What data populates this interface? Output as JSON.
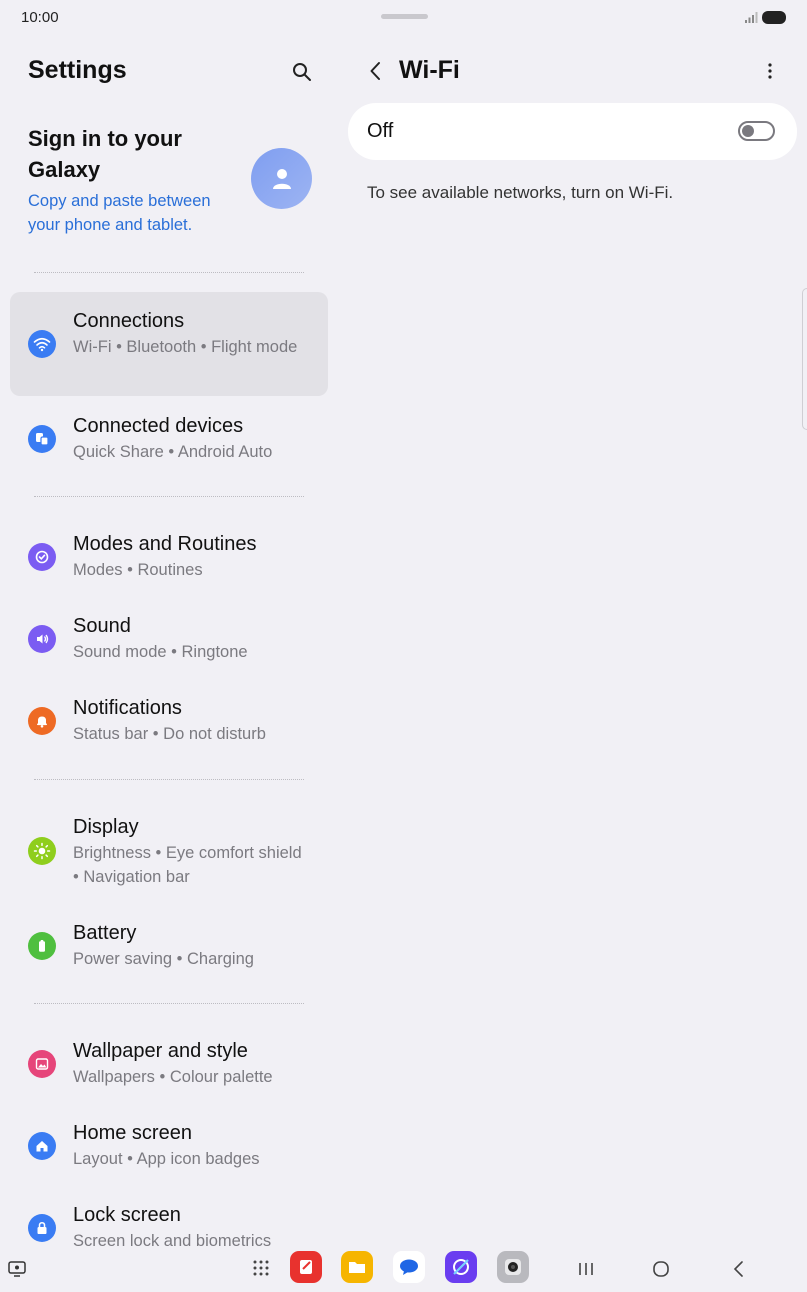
{
  "status_bar": {
    "time": "10:00"
  },
  "left_pane": {
    "title": "Settings",
    "account": {
      "title": "Sign in to your Galaxy",
      "subtitle": "Copy and paste between your phone and tablet."
    },
    "items": [
      {
        "title": "Connections",
        "subtitle": "Wi-Fi  •  Bluetooth  •  Flight mode",
        "icon": "wifi-icon",
        "color": "#3a7cf3",
        "selected": true
      },
      {
        "title": "Connected devices",
        "subtitle": "Quick Share  •  Android Auto",
        "icon": "devices-icon",
        "color": "#3a7cf3"
      },
      {
        "title": "Modes and Routines",
        "subtitle": "Modes  •  Routines",
        "icon": "routines-icon",
        "color": "#7b5cf2"
      },
      {
        "title": "Sound",
        "subtitle": "Sound mode  •  Ringtone",
        "icon": "speaker-icon",
        "color": "#7b5cf2"
      },
      {
        "title": "Notifications",
        "subtitle": "Status bar  •  Do not disturb",
        "icon": "bell-icon",
        "color": "#ee6a24"
      },
      {
        "title": "Display",
        "subtitle": "Brightness  •  Eye comfort shield  •  Navigation bar",
        "icon": "sun-icon",
        "color": "#8fce1d"
      },
      {
        "title": "Battery",
        "subtitle": "Power saving  •  Charging",
        "icon": "battery-icon",
        "color": "#4fbf3f"
      },
      {
        "title": "Wallpaper and style",
        "subtitle": "Wallpapers  •  Colour palette",
        "icon": "wallpaper-icon",
        "color": "#e6457a"
      },
      {
        "title": "Home screen",
        "subtitle": "Layout  •  App icon badges",
        "icon": "home-icon",
        "color": "#3a7cf3"
      },
      {
        "title": "Lock screen",
        "subtitle": "Screen lock and biometrics",
        "icon": "lock-icon",
        "color": "#3a7cf3"
      }
    ]
  },
  "right_pane": {
    "title": "Wi-Fi",
    "wifi_state_label": "Off",
    "wifi_enabled": false,
    "hint": "To see available networks, turn on Wi-Fi."
  },
  "nav_bar": {
    "apps": [
      "app-drawer-icon",
      "notes-app-icon",
      "files-app-icon",
      "messages-app-icon",
      "internet-app-icon",
      "camera-app-icon"
    ]
  }
}
